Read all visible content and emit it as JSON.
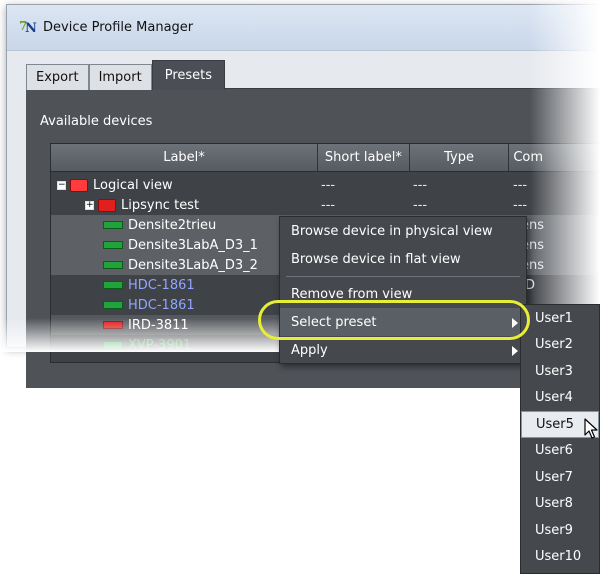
{
  "window": {
    "title": "Device Profile Manager"
  },
  "tabs": [
    {
      "label": "Export",
      "active": false
    },
    {
      "label": "Import",
      "active": false
    },
    {
      "label": "Presets",
      "active": true
    }
  ],
  "panel": {
    "available_label": "Available devices"
  },
  "table": {
    "columns": [
      "Label*",
      "Short label*",
      "Type",
      "Com"
    ],
    "rows": [
      {
        "label": "Logical view",
        "short": "---",
        "type": "---",
        "com": "---",
        "icon": "folder-open-icon"
      },
      {
        "label": "Lipsync test",
        "short": "---",
        "type": "---",
        "com": "---",
        "icon": "folder-icon"
      },
      {
        "label": "Densite2trieu",
        "com": "ens",
        "icon": "green-device-icon"
      },
      {
        "label": "Densite3LabA_D3_1",
        "com": "ens",
        "icon": "green-device-icon"
      },
      {
        "label": "Densite3LabA_D3_2",
        "com": "ens",
        "icon": "green-device-icon"
      },
      {
        "label": "HDC-1861",
        "com": "D",
        "icon": "green-device-icon"
      },
      {
        "label": "HDC-1861",
        "icon": "green-device-icon"
      },
      {
        "label": "IRD-3811",
        "icon": "red-device-icon"
      },
      {
        "label": "XVP-3901",
        "icon": "green-device-icon"
      }
    ]
  },
  "context_menu": {
    "items": [
      {
        "label": "Browse device in physical view"
      },
      {
        "label": "Browse device in flat view"
      },
      {
        "label": "Remove from view"
      },
      {
        "label": "Select preset",
        "highlighted": true
      },
      {
        "label": "Apply"
      }
    ]
  },
  "submenu": {
    "items": [
      "User1",
      "User2",
      "User3",
      "User4",
      "User5",
      "User6",
      "User7",
      "User8",
      "User9",
      "User10"
    ],
    "hovered": "User5"
  },
  "colors": {
    "highlight_ring": "#e7ee36",
    "panel_bg": "#4f5358",
    "menu_bg": "#45494e"
  }
}
